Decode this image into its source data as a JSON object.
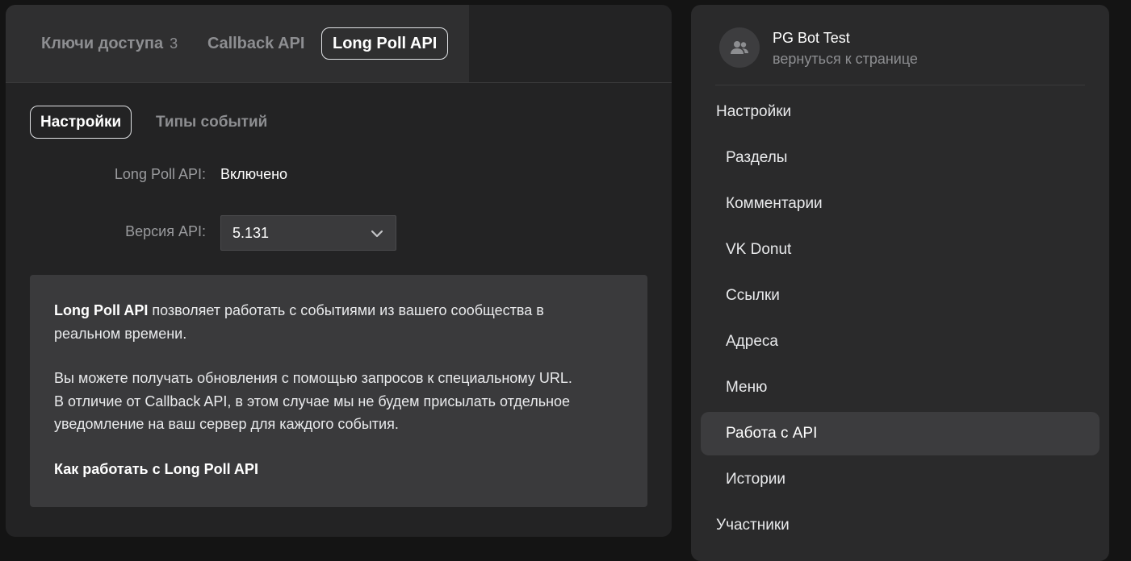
{
  "top_tabs": [
    {
      "label": "Ключи доступа",
      "count": "3"
    },
    {
      "label": "Callback API"
    },
    {
      "label": "Long Poll API"
    }
  ],
  "sub_tabs": [
    {
      "label": "Настройки"
    },
    {
      "label": "Типы событий"
    }
  ],
  "fields": {
    "longpoll_label": "Long Poll API:",
    "longpoll_value": "Включено",
    "version_label": "Версия API:",
    "version_value": "5.131"
  },
  "info": {
    "p1_bold": "Long Poll API",
    "p1_line1": " позволяет работать с событиями из вашего сообщества в",
    "p1_line2": "реальном времени.",
    "p2_line1": "Вы можете получать обновления с помощью запросов к специальному URL.",
    "p2_line2": "В отличие от Callback API, в этом случае мы не будем присылать отдельное",
    "p2_line3": "уведомление на ваш сервер для каждого события.",
    "link": "Как работать с Long Poll API"
  },
  "sidebar": {
    "group_name": "PG Bot Test",
    "group_sub": "вернуться к странице",
    "items": [
      {
        "label": "Настройки"
      },
      {
        "label": "Разделы"
      },
      {
        "label": "Комментарии"
      },
      {
        "label": "VK Donut"
      },
      {
        "label": "Ссылки"
      },
      {
        "label": "Адреса"
      },
      {
        "label": "Меню"
      },
      {
        "label": "Работа с API"
      },
      {
        "label": "Истории"
      },
      {
        "label": "Участники"
      }
    ]
  },
  "colors": {
    "background": "#141414",
    "panel": "#232324",
    "sidebar": "#2a2a2b",
    "selected": "#3c3c3e"
  },
  "icons": {
    "avatar": "users-icon",
    "select": "chevron-down-icon"
  }
}
